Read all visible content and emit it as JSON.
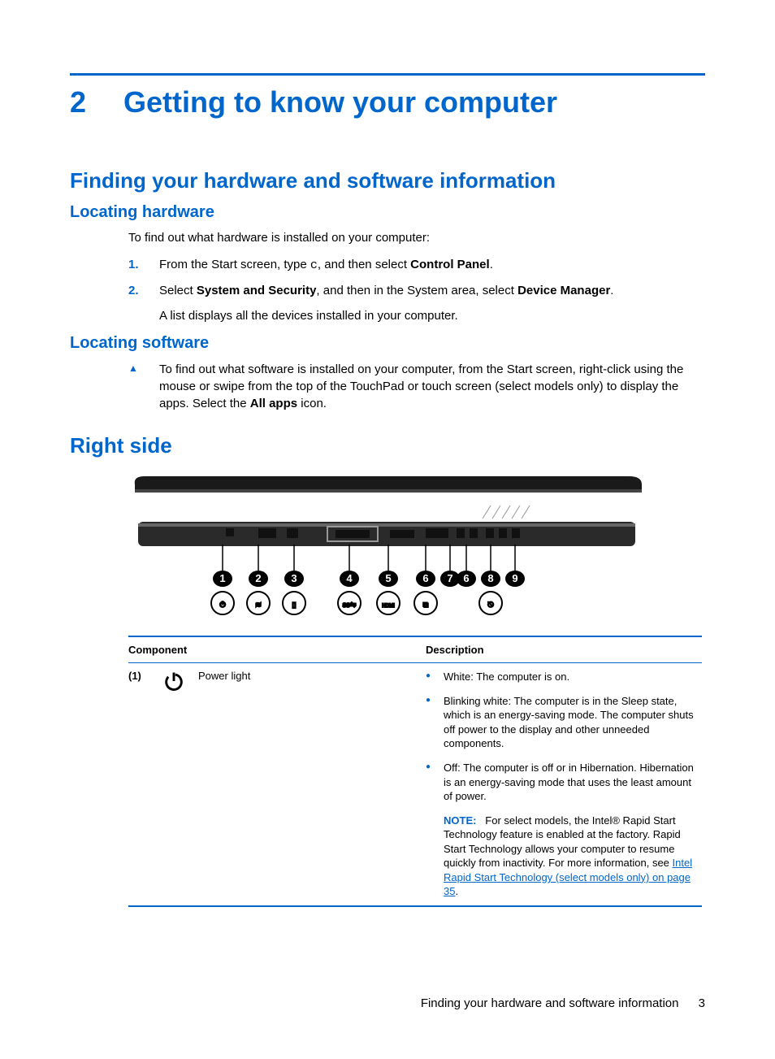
{
  "chapter": {
    "number": "2",
    "title": "Getting to know your computer"
  },
  "section1": {
    "title": "Finding your hardware and software information",
    "sub_hw": {
      "title": "Locating hardware",
      "intro": "To find out what hardware is installed on your computer:",
      "steps": [
        {
          "n": "1.",
          "pre": "From the Start screen, type ",
          "code": "c",
          "mid": ", and then select ",
          "bold": "Control Panel",
          "post": "."
        },
        {
          "n": "2.",
          "pre": "Select ",
          "bold1": "System and Security",
          "mid": ", and then in the System area, select ",
          "bold2": "Device Manager",
          "post": "."
        }
      ],
      "after": "A list displays all the devices installed in your computer."
    },
    "sub_sw": {
      "title": "Locating software",
      "item_pre": "To find out what software is installed on your computer, from the Start screen, right-click using the mouse or swipe from the top of the TouchPad or touch screen (select models only) to display the apps. Select the ",
      "item_bold": "All apps",
      "item_post": " icon."
    }
  },
  "section2": {
    "title": "Right side",
    "callouts": [
      "1",
      "2",
      "3",
      "4",
      "5",
      "6",
      "7",
      "6",
      "8",
      "9"
    ],
    "sub_icons": [
      "power",
      "vent",
      "sd",
      "ss",
      "hdmi",
      "rj45",
      "none",
      "none",
      "plug",
      "none"
    ],
    "table": {
      "headers": {
        "component": "Component",
        "description": "Description"
      },
      "row1": {
        "num": "(1)",
        "name": "Power light",
        "bullets": [
          "White: The computer is on.",
          "Blinking white: The computer is in the Sleep state, which is an energy-saving mode. The computer shuts off power to the display and other unneeded components.",
          "Off: The computer is off or in Hibernation. Hibernation is an energy-saving mode that uses the least amount of power."
        ],
        "note_label": "NOTE:",
        "note_text": "For select models, the Intel® Rapid Start Technology feature is enabled at the factory. Rapid Start Technology allows your computer to resume quickly from inactivity. For more information, see ",
        "note_link": "Intel Rapid Start Technology (select models only) on page 35",
        "note_post": "."
      }
    }
  },
  "footer": {
    "text": "Finding your hardware and software information",
    "page": "3"
  }
}
